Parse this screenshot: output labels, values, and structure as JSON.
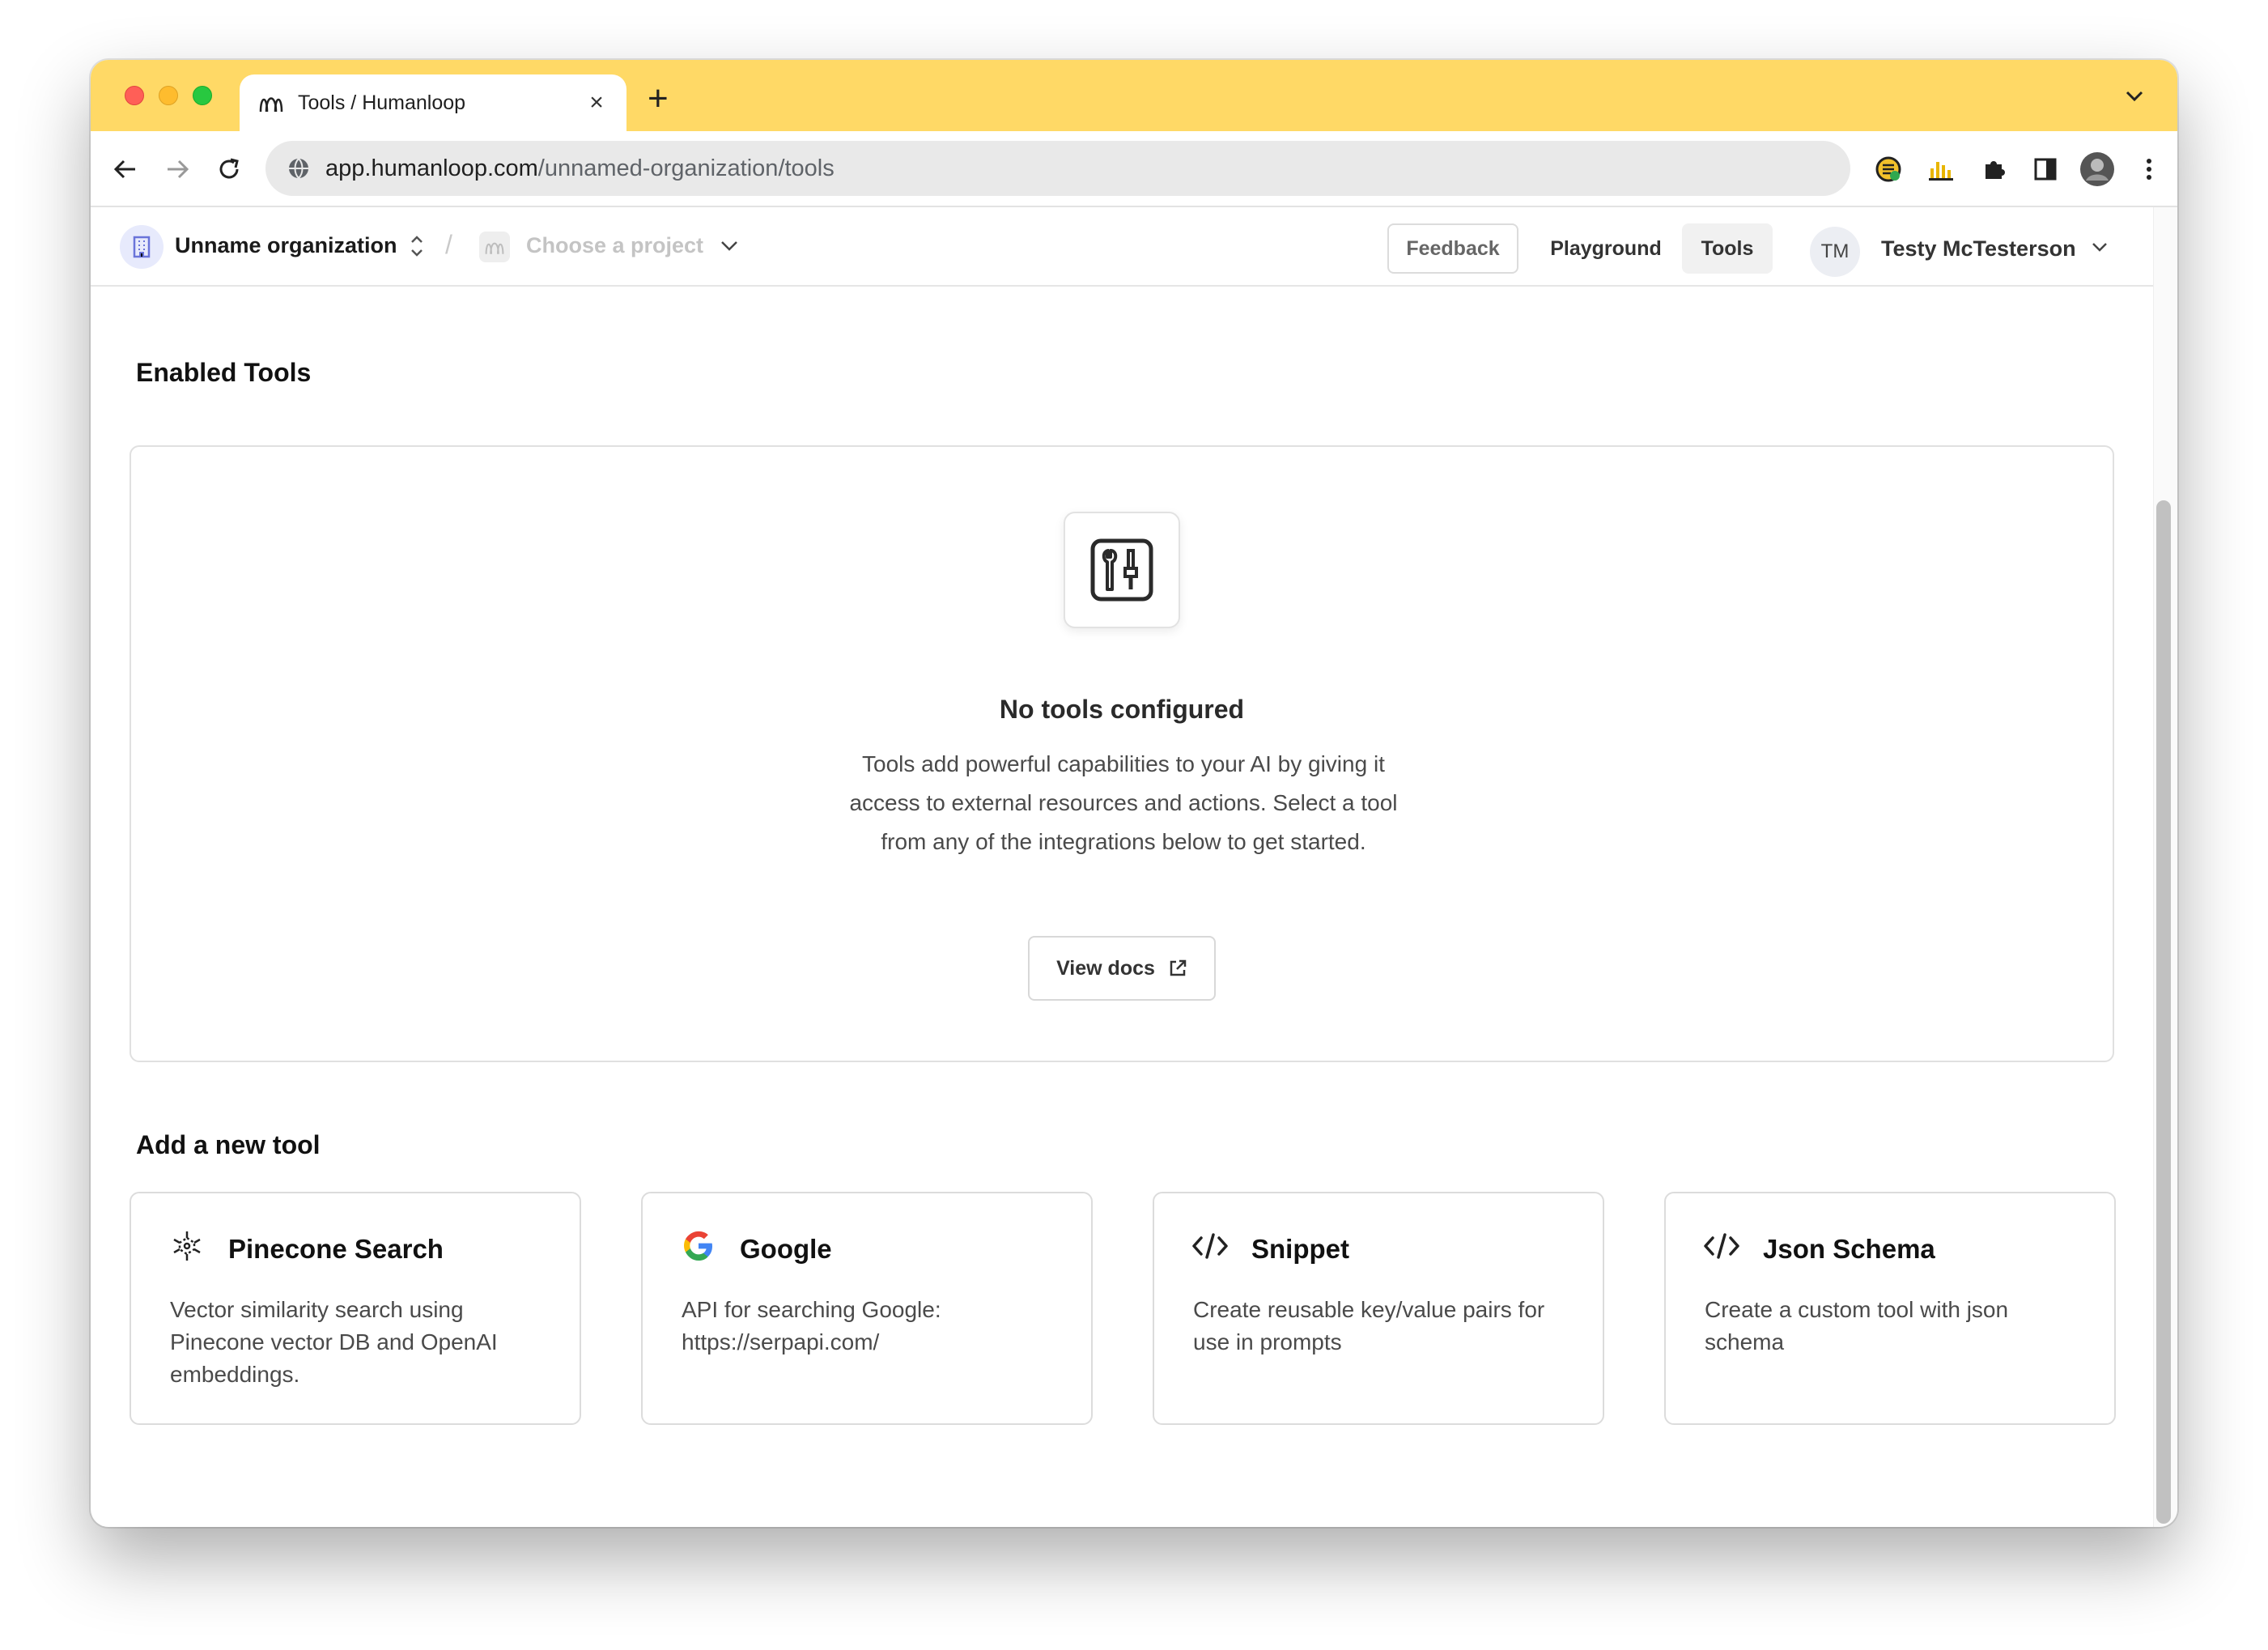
{
  "browser": {
    "tab_title": "Tools / Humanloop",
    "tab_close": "×",
    "new_tab": "+",
    "url_host": "app.humanloop.com",
    "url_path": "/unnamed-organization/tools"
  },
  "header": {
    "org_name": "Unname organization",
    "separator": "/",
    "project_placeholder": "Choose a project",
    "feedback_label": "Feedback",
    "playground_label": "Playground",
    "tools_label": "Tools",
    "avatar_initials": "TM",
    "user_name": "Testy McTesterson"
  },
  "main": {
    "enabled_title": "Enabled Tools",
    "empty_title": "No tools configured",
    "empty_desc": "Tools add powerful capabilities to your AI by giving it access to external resources and actions. Select a tool from any of the integrations below to get started.",
    "docs_label": "View docs",
    "add_title": "Add a new tool",
    "tools": [
      {
        "name": "Pinecone Search",
        "desc": "Vector similarity search using Pinecone vector DB and OpenAI embeddings.",
        "icon": "pinecone-icon"
      },
      {
        "name": "Google",
        "desc": "API for searching Google: https://serpapi.com/",
        "icon": "google-icon"
      },
      {
        "name": "Snippet",
        "desc": "Create reusable key/value pairs for use in prompts",
        "icon": "code-icon"
      },
      {
        "name": "Json Schema",
        "desc": "Create a custom tool with json schema",
        "icon": "code-icon"
      }
    ]
  },
  "colors": {
    "tabstrip": "#ffd966",
    "accent": "#e7eafc"
  }
}
